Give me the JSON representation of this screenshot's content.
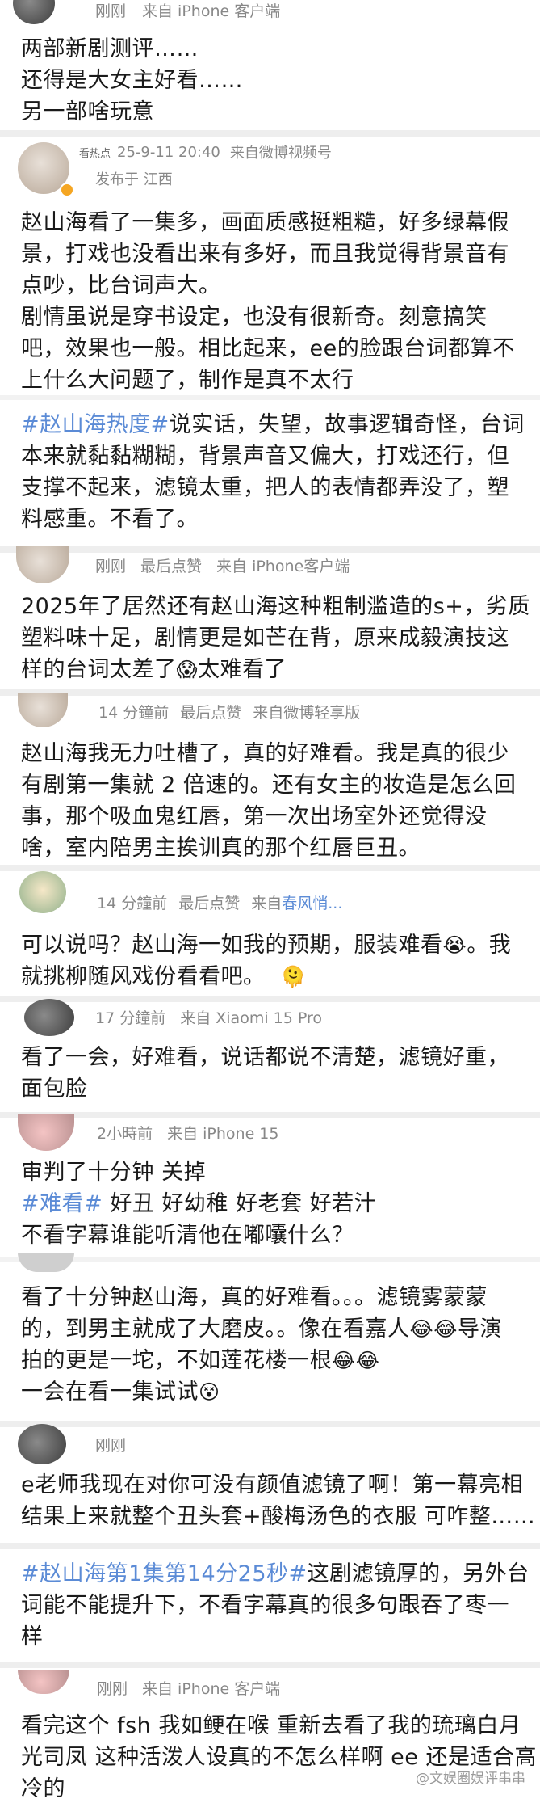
{
  "comments": [
    {
      "meta": {
        "time": "刚刚",
        "source": "来自 iPhone 客户端"
      },
      "lines": [
        "两部新剧测评……",
        "还得是大女主好看……",
        "另一部啥玩意"
      ]
    },
    {
      "meta": {
        "username": "看热点",
        "time": "25-9-11 20:40",
        "source": "来自微博视频号",
        "location": "发布于 江西"
      },
      "paragraphs": [
        [
          "赵山海看了一集多，画面质感挺粗糙，好多绿幕假",
          "景，打戏也没看出来有多好，而且我觉得背景音有",
          "点吵，比台词声大。",
          "剧情虽说是穿书设定，也没有很新奇。刻意搞笑",
          "吧，效果也一般。相比起来，ee的脸跟台词都算不",
          "上什么大问题了，制作是真不太行"
        ],
        [
          "说实话，失望，故事逻辑奇怪，台词",
          "本来就黏黏糊糊，背景声音又偏大，打戏还行，但",
          "支撑不起来，滤镜太重，把人的表情都弄没了，塑",
          "料感重。不看了。"
        ]
      ],
      "hashtag": "#赵山海热度#"
    },
    {
      "meta": {
        "time": "刚刚",
        "tag": "最后点赞",
        "source": "来自 iPhone客户端"
      },
      "lines": [
        "2025年了居然还有赵山海这种粗制滥造的s+，劣质",
        "塑料味十足，剧情更是如芒在背，原来成毅演技这",
        "样的台词太差了",
        "太难看了"
      ]
    },
    {
      "meta": {
        "time": "14 分鐘前",
        "tag": "最后点赞",
        "source": "来自微博轻享版"
      },
      "lines": [
        "赵山海我无力吐槽了，真的好难看。我是真的很少",
        "有剧第一集就 2 倍速的。还有女主的妆造是怎么回",
        "事，那个吸血鬼红唇，第一次出场室外还觉得没",
        "啥，室内陪男主挨训真的那个红唇巨丑。"
      ]
    },
    {
      "meta": {
        "time": "14 分鐘前",
        "tag": "最后点赞",
        "source_prefix": "来自",
        "source_hl": "春风悄..."
      },
      "lines": [
        "可以说吗？赵山海一如我的预期，服装难看",
        "。我",
        "就挑柳随风戏份看看吧。"
      ]
    },
    {
      "meta": {
        "time": "17 分鐘前",
        "source": "来自 Xiaomi 15 Pro"
      },
      "lines": [
        "看了一会，好难看，说话都说不清楚，滤镜好重，",
        "面包脸"
      ]
    },
    {
      "meta": {
        "time": "2小時前",
        "source": "来自 iPhone 15"
      },
      "lines": [
        "审判了十分钟 关掉",
        "好丑 好幼稚 好老套 好若汁",
        "不看字幕谁能听清他在嘟囔什么？"
      ],
      "hashtag": "#难看#"
    },
    {
      "meta": {},
      "lines": [
        "看了十分钟赵山海，真的好难看。。。滤镜雾蒙蒙",
        "的，到男主就成了大磨皮。。像在看嘉人",
        "导演",
        "拍的更是一坨，不如莲花楼一根",
        "一会在看一集试试"
      ]
    },
    {
      "meta": {
        "time": "刚刚"
      },
      "lines": [
        "e老师我现在对你可没有颜值滤镜了啊！第一幕亮相",
        "结果上来就整个丑头套+酸梅汤色的衣服 可咋整……"
      ]
    },
    {
      "meta": {},
      "lines": [
        "这剧滤镜厚的，另外台",
        "词能不能提升下，不看字幕真的很多句跟吞了枣一",
        "样"
      ],
      "hashtag": "#赵山海第1集第14分25秒#"
    },
    {
      "meta": {
        "time": "刚刚",
        "source": "来自 iPhone 客户端"
      },
      "lines": [
        "看完这个 fsh 我如鲠在喉 重新去看了我的琉璃白月",
        "光司凤 这种活泼人设真的不怎么样啊 ee 还是适合高",
        "冷的"
      ]
    }
  ],
  "watermark": "@文娱圈娱评串串",
  "icons": {
    "shocked": "😱",
    "laugh_cry": "😂",
    "cry": "😭",
    "dizzy": "😵",
    "melt": "🫠"
  }
}
